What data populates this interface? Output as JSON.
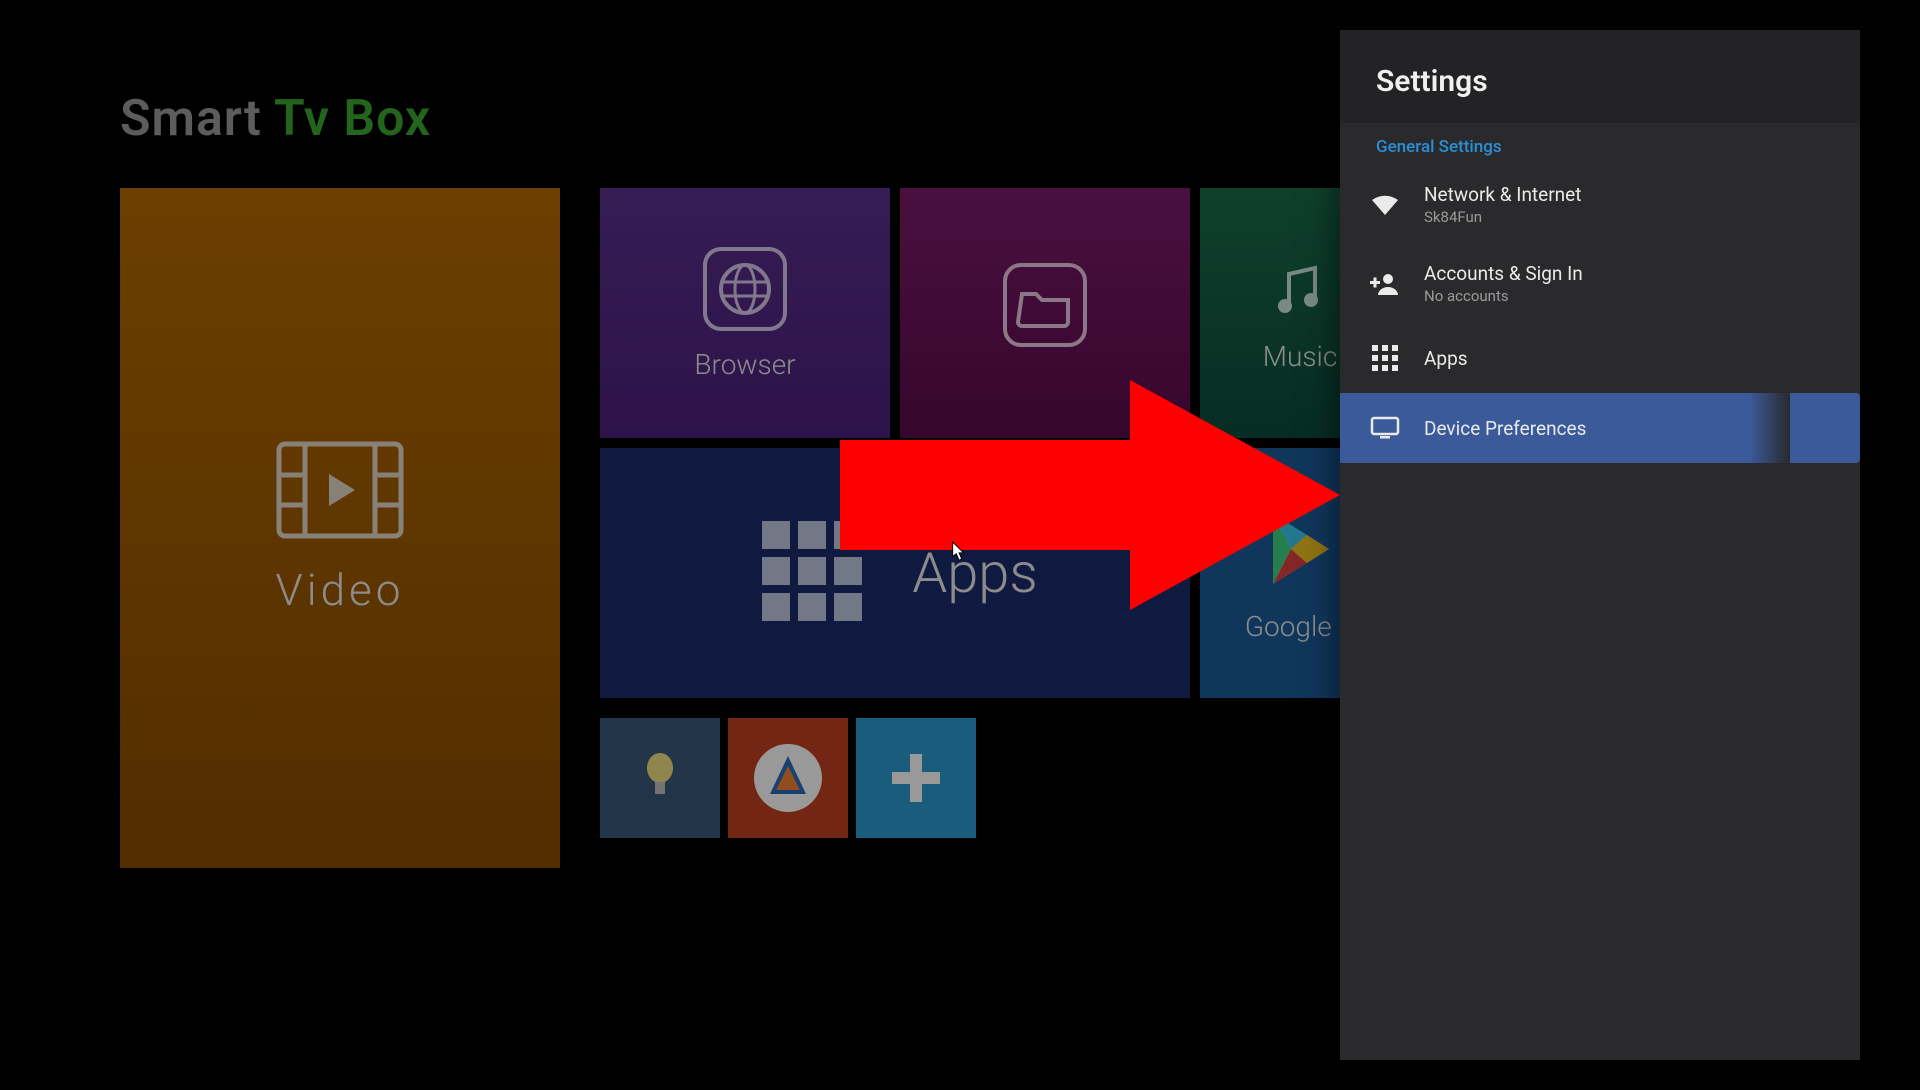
{
  "brand": {
    "smart": "Smart",
    "tvbox": "Tv Box"
  },
  "tiles": {
    "video": "Video",
    "browser": "Browser",
    "file": "",
    "music": "Music",
    "apps": "Apps",
    "store": "Google S"
  },
  "settings": {
    "title": "Settings",
    "section": "General Settings",
    "items": [
      {
        "icon": "wifi",
        "title": "Network & Internet",
        "sub": "Sk84Fun",
        "selected": false
      },
      {
        "icon": "account-add",
        "title": "Accounts & Sign In",
        "sub": "No accounts",
        "selected": false
      },
      {
        "icon": "apps-grid",
        "title": "Apps",
        "sub": "",
        "selected": false
      },
      {
        "icon": "monitor",
        "title": "Device Preferences",
        "sub": "",
        "selected": true
      }
    ]
  },
  "colors": {
    "accent_link": "#2a8fd6",
    "selected_bg": "#3a5a9a",
    "arrow": "#ff0000"
  }
}
